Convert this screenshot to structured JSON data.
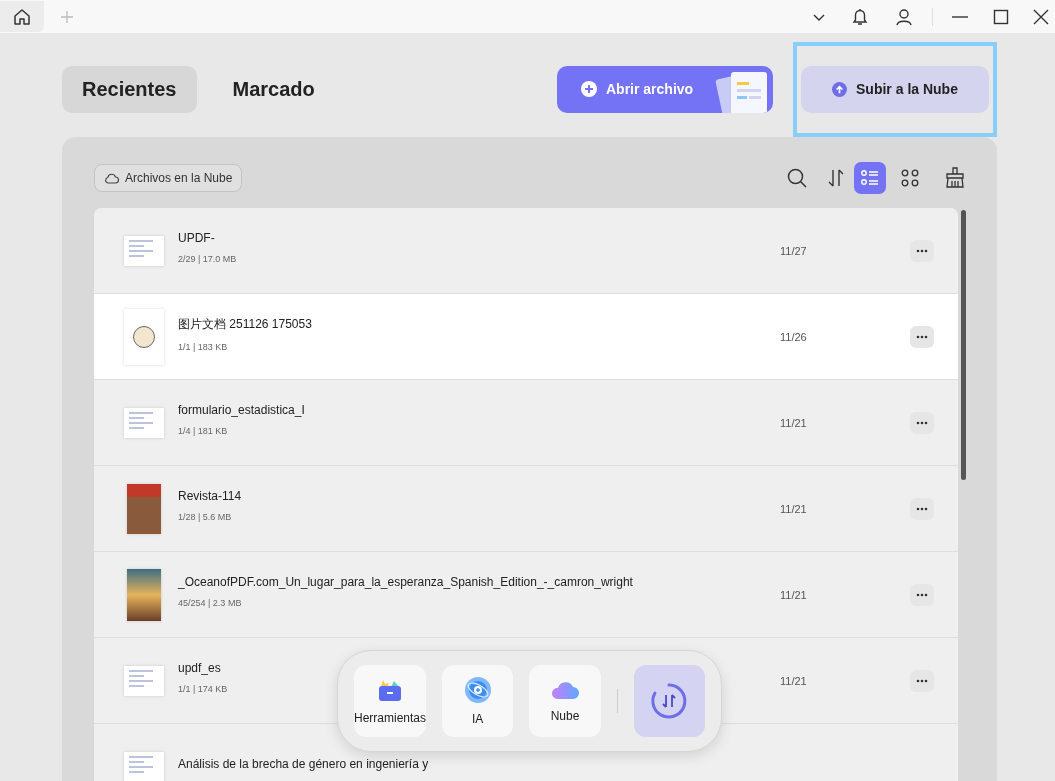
{
  "tabs": [
    {
      "label": "Recientes",
      "selected": true
    },
    {
      "label": "Marcado",
      "selected": false
    }
  ],
  "actions": [
    {
      "kind": "open",
      "label": "Abrir archivo",
      "highlighted": false
    },
    {
      "kind": "upload",
      "label": "Subir a la Nube",
      "highlighted": true
    }
  ],
  "cloud_filter": {
    "label": "Archivos en la Nube"
  },
  "view_modes": [
    {
      "kind": "list",
      "selected": true
    },
    {
      "kind": "grid",
      "selected": false
    }
  ],
  "files": [
    {
      "name": "UPDF-",
      "meta": "2/29 | 17.0 MB",
      "date": "11/27",
      "kind": "page",
      "selected": false
    },
    {
      "name": "图片文档 251126 175053",
      "meta": "1/1 | 183 KB",
      "date": "11/26",
      "kind": "sketch",
      "selected": true
    },
    {
      "name": "formulario_estadistica_I",
      "meta": "1/4 | 181 KB",
      "date": "11/21",
      "kind": "page",
      "selected": false
    },
    {
      "name": "Revista-114",
      "meta": "1/28 | 5.6 MB",
      "date": "11/21",
      "kind": "cover",
      "selected": false
    },
    {
      "name": "_OceanofPDF.com_Un_lugar_para_la_esperanza_Spanish_Edition_-_camron_wright",
      "meta": "45/254 | 2.3 MB",
      "date": "11/21",
      "kind": "photo",
      "selected": false
    },
    {
      "name": "updf_es",
      "meta": "1/1 | 174 KB",
      "date": "11/21",
      "kind": "page",
      "selected": false
    },
    {
      "name": "Análisis de la brecha de género en ingeniería y",
      "kind": "page",
      "selected": false
    }
  ],
  "dock": [
    {
      "kind": "tools",
      "label": "Herramientas",
      "selected": false
    },
    {
      "kind": "ai",
      "label": "IA",
      "selected": false
    },
    {
      "kind": "cloud",
      "label": "Nube",
      "selected": false
    },
    {
      "kind": "sync",
      "selected": true
    }
  ]
}
